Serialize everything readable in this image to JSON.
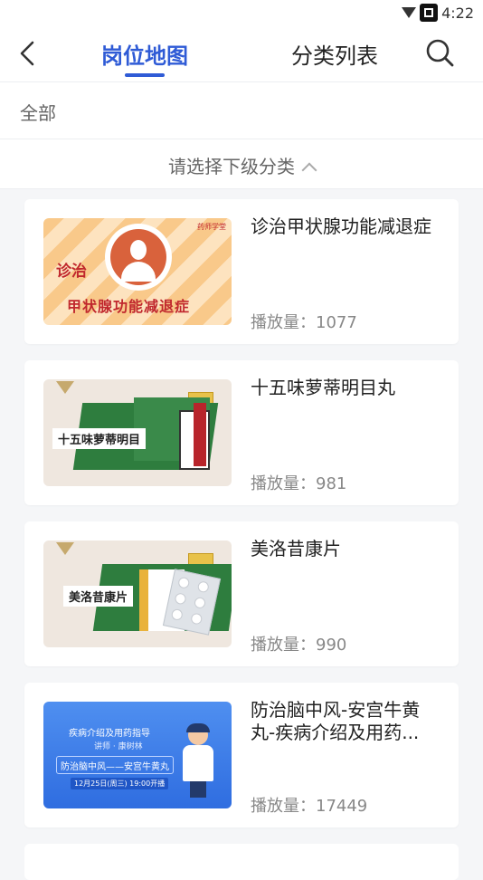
{
  "status": {
    "time": "4:22"
  },
  "nav": {
    "tabs": [
      {
        "label": "岗位地图",
        "active": true
      },
      {
        "label": "分类列表",
        "active": false
      }
    ]
  },
  "filter": {
    "all_label": "全部",
    "subcategory_label": "请选择下级分类"
  },
  "videos": [
    {
      "title": "诊治甲状腺功能减退症",
      "plays_label": "播放量：1077",
      "thumb_texts": {
        "line1": "诊治",
        "line2": "甲状腺功能减退症",
        "brand": "药师学堂"
      }
    },
    {
      "title": "十五味萝蒂明目丸",
      "plays_label": "播放量：981",
      "thumb_texts": {
        "strip": "十五味萝蒂明目"
      }
    },
    {
      "title": "美洛昔康片",
      "plays_label": "播放量：990",
      "thumb_texts": {
        "strip": "美洛昔康片"
      }
    },
    {
      "title": "防治脑中风-安宫牛黄丸-疾病介绍及用药...",
      "plays_label": "播放量：17449",
      "thumb_texts": {
        "line1": "疾病介绍及用药指导",
        "line2": "讲师 · 康树林",
        "banner": "防治脑中风——安宫牛黄丸",
        "date": "12月25日(周三) 19:00开播"
      }
    }
  ],
  "colors": {
    "accent": "#2f5bd6",
    "background": "#f5f6f8",
    "muted_text": "#888888"
  },
  "icons": [
    "back-arrow-icon",
    "search-icon",
    "chevron-up-icon",
    "wifi-icon",
    "scan-icon"
  ]
}
